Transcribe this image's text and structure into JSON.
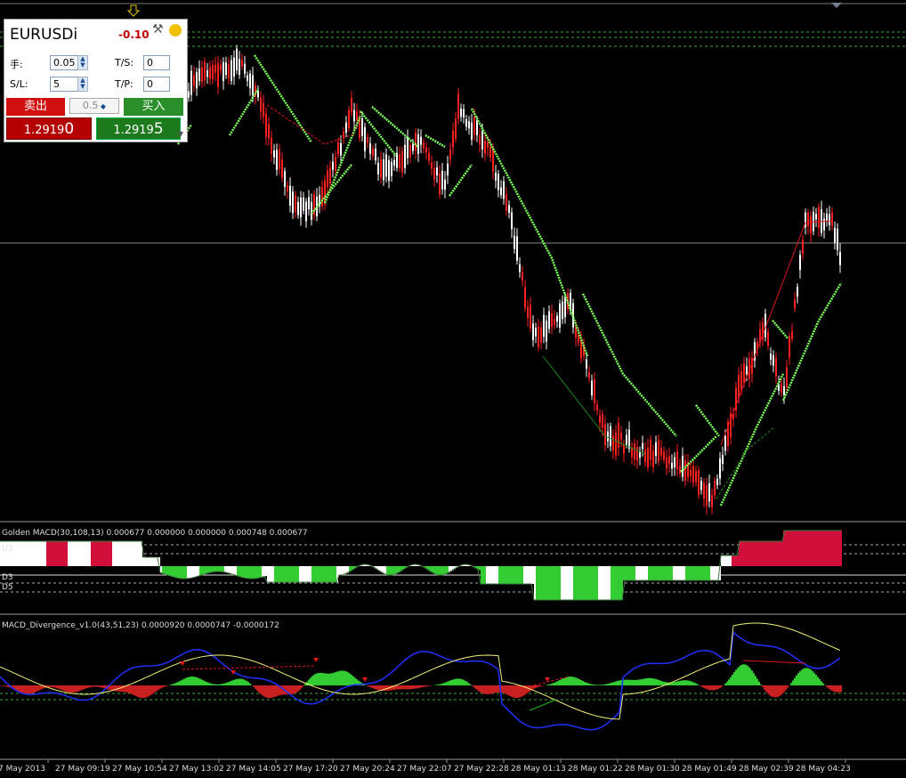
{
  "panel": {
    "symbol": "EURUSDi",
    "change": "-0.10",
    "lots_label": "手:",
    "lots_value": "0.05",
    "ts_label": "T/S:",
    "ts_value": "0",
    "sl_label": "S/L:",
    "sl_value": "5",
    "tp_label": "T/P:",
    "tp_value": "0",
    "sell_label": "卖出",
    "buy_label": "买入",
    "lot_step": "0.5",
    "bid_main": "1.2919",
    "bid_tail": "0",
    "ask_main": "1.2919",
    "ask_tail": "5"
  },
  "indicators": {
    "golden_macd": "Golden MACD(30,108,13) 0.000677 0.000000 0.000000 0.000748 0.000677",
    "level_d3": "D3",
    "level_d5": "D5",
    "level_u3": "U3",
    "macd_div": "MACD_Divergence_v1.0(43,51,23) 0.0000920 0.0000747 -0.0000172"
  },
  "time_axis": [
    "7 May 2013",
    "27 May 09:19",
    "27 May 10:54",
    "27 May 13:02",
    "27 May 14:05",
    "27 May 17:20",
    "27 May 20:24",
    "27 May 22:07",
    "27 May 22:28",
    "28 May 01:13",
    "28 May 01:22",
    "28 May 01:30",
    "28 May 01:49",
    "28 May 02:39",
    "28 May 04:23"
  ],
  "colors": {
    "background": "#000000",
    "bull_candle": "#ff2020",
    "bear_candle": "#ffffff",
    "trail": "#7cff5a",
    "hist_up": "#d0103a",
    "hist_down": "#33cc33"
  },
  "icons": {
    "tools": "tools-icon",
    "sun": "sun-icon",
    "marker": "down-arrow-icon"
  }
}
